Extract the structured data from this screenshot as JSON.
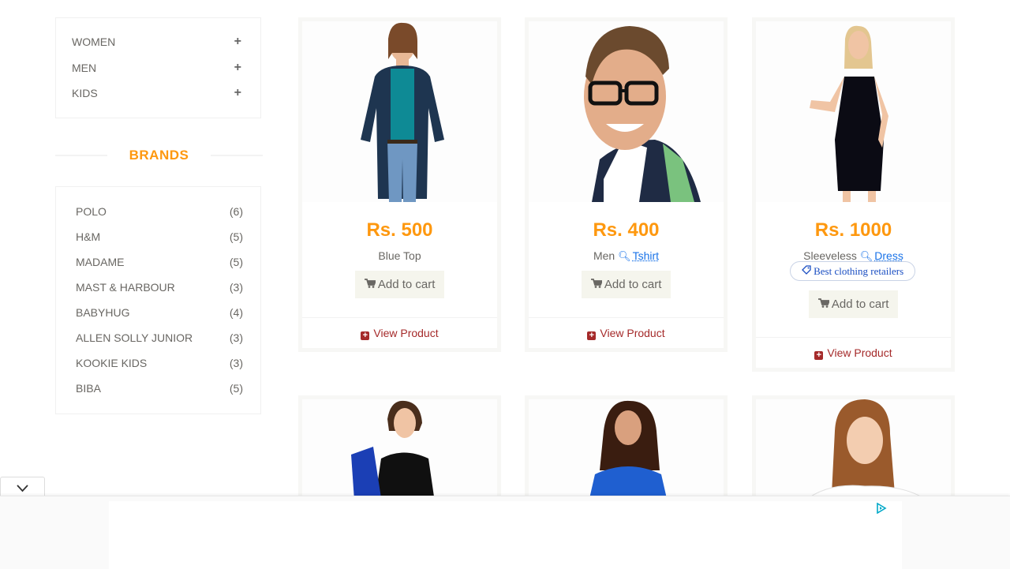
{
  "categories": [
    {
      "label": "WOMEN",
      "expand": "+"
    },
    {
      "label": "MEN",
      "expand": "+"
    },
    {
      "label": "KIDS",
      "expand": "+"
    }
  ],
  "brands": {
    "title": "BRANDS",
    "items": [
      {
        "name": "POLO",
        "count": "(6)"
      },
      {
        "name": "H&M",
        "count": "(5)"
      },
      {
        "name": "MADAME",
        "count": "(5)"
      },
      {
        "name": "MAST & HARBOUR",
        "count": "(3)"
      },
      {
        "name": "BABYHUG",
        "count": "(4)"
      },
      {
        "name": "ALLEN SOLLY JUNIOR",
        "count": "(3)"
      },
      {
        "name": "KOOKIE KIDS",
        "count": "(3)"
      },
      {
        "name": "BIBA",
        "count": "(5)"
      }
    ]
  },
  "products": [
    {
      "price": "Rs. 500",
      "name": "Blue Top",
      "tag": "",
      "ad_pill": "",
      "cart_label": "Add to cart",
      "view_label": "View Product"
    },
    {
      "price": "Rs. 400",
      "name": "Men",
      "tag": "Tshirt",
      "ad_pill": "",
      "cart_label": "Add to cart",
      "view_label": "View Product"
    },
    {
      "price": "Rs. 1000",
      "name": "Sleeveless",
      "tag": "Dress",
      "ad_pill": "Best clothing retailers",
      "cart_label": "Add to cart",
      "view_label": "View Product"
    }
  ],
  "colors": {
    "accent": "#FE980F",
    "link": "#1a73e8",
    "view": "#a52a2a"
  },
  "icons": {
    "expand": "plus-icon",
    "cart": "cart-icon",
    "view": "plus-square-icon",
    "collapse": "chevron-down-icon",
    "ad": "adchoices-icon",
    "search": "search-icon",
    "tag": "tag-icon"
  }
}
